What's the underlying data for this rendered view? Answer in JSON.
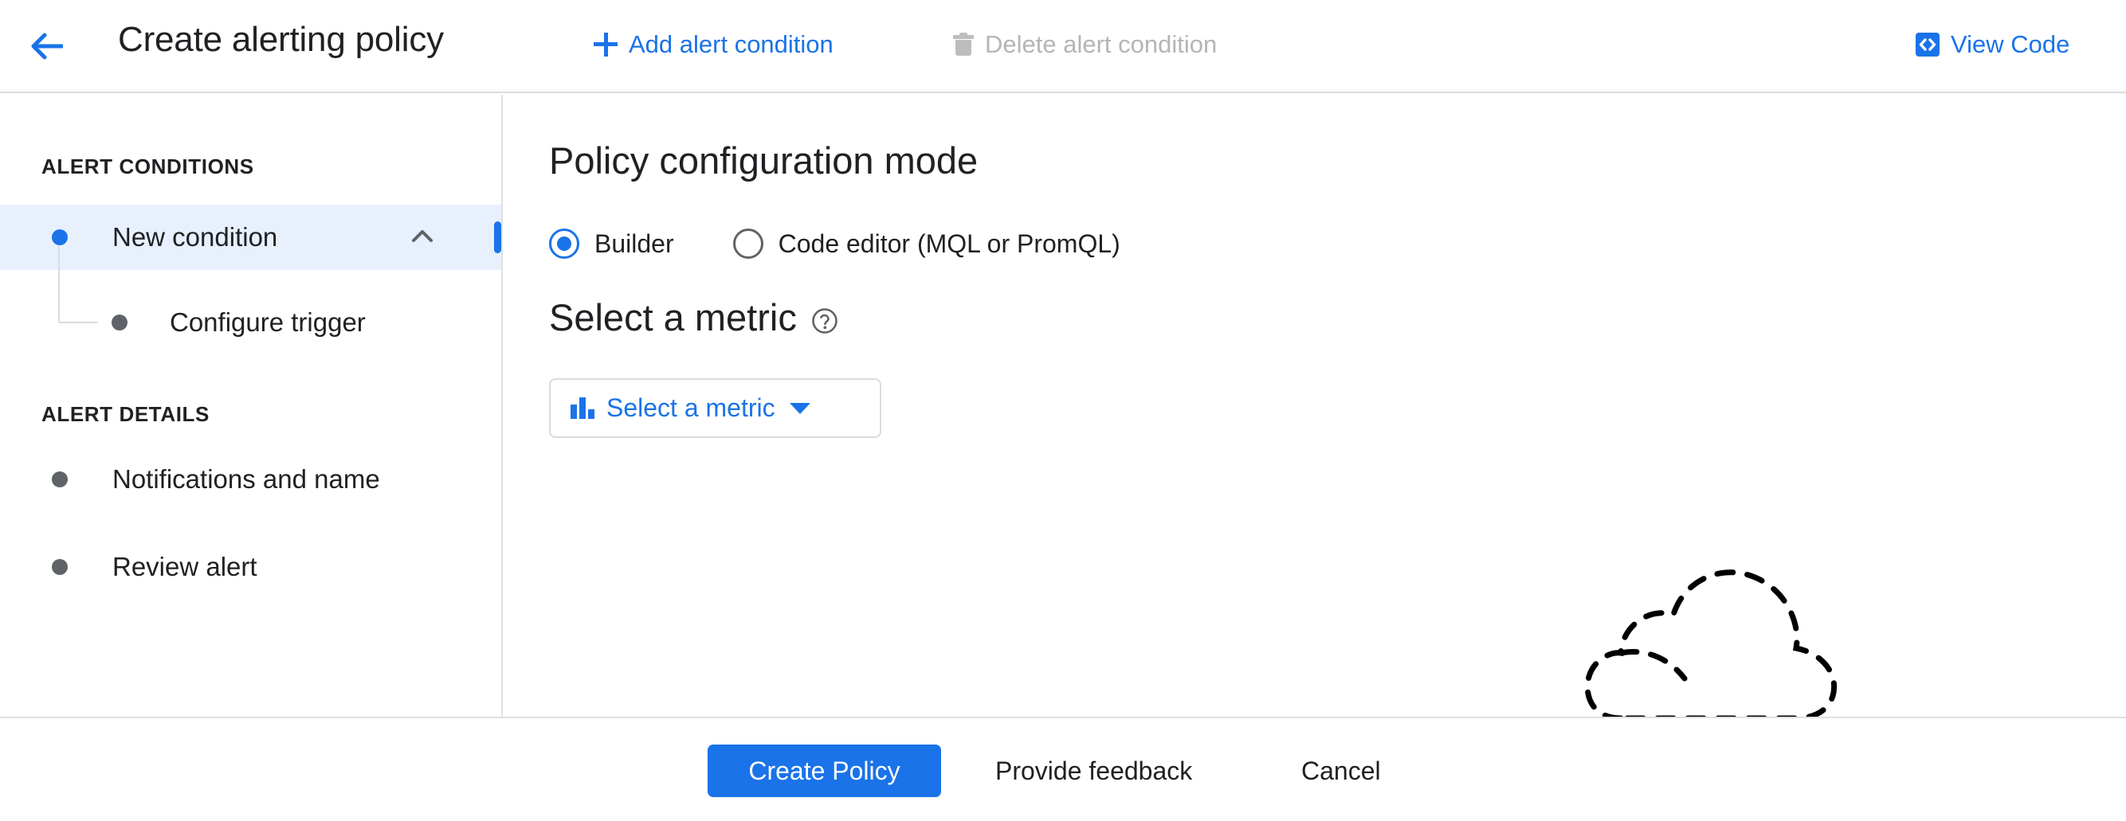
{
  "header": {
    "back_icon": "arrow-back-icon",
    "title": "Create alerting policy",
    "add_condition_label": "Add alert condition",
    "add_condition_icon": "plus-icon",
    "delete_condition_label": "Delete alert condition",
    "delete_condition_icon": "trash-icon",
    "view_code_label": "View Code",
    "view_code_icon": "code-brackets-icon"
  },
  "sidebar": {
    "section_1_label": "ALERT CONDITIONS",
    "section_2_label": "ALERT DETAILS",
    "items": [
      {
        "label": "New condition",
        "icon": "bullet-dot-icon",
        "expand_icon": "chevron-up-icon",
        "active": true
      },
      {
        "label": "Configure trigger",
        "icon": "bullet-dot-icon",
        "active": false
      },
      {
        "label": "Notifications and name",
        "icon": "bullet-dot-icon",
        "active": false
      },
      {
        "label": "Review alert",
        "icon": "bullet-dot-icon",
        "active": false
      }
    ]
  },
  "main": {
    "policy_mode_heading": "Policy configuration mode",
    "radios": [
      {
        "label": "Builder",
        "selected": true
      },
      {
        "label": "Code editor (MQL or PromQL)",
        "selected": false
      }
    ],
    "select_metric_heading": "Select a metric",
    "help_icon": "help-circle-icon",
    "metric_button_label": "Select a metric",
    "metric_button_icon": "bar-chart-icon",
    "metric_button_caret": "caret-down-icon",
    "illustration": "dashed-cloud-illustration"
  },
  "footer": {
    "create_label": "Create Policy",
    "feedback_label": "Provide feedback",
    "cancel_label": "Cancel"
  },
  "colors": {
    "accent": "#1a73e8",
    "active_row_bg": "#e8f0fe",
    "text": "#202124",
    "muted": "#5f6368",
    "disabled": "#b5b5b5",
    "border": "#dadce0"
  }
}
